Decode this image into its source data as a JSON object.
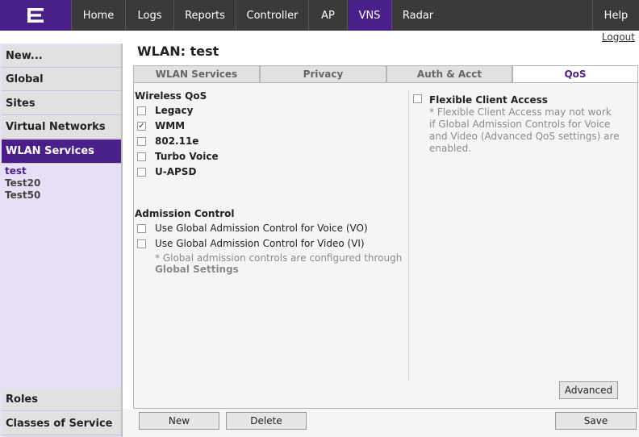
{
  "nav": {
    "items": [
      "Home",
      "Logs",
      "Reports",
      "Controller",
      "AP",
      "VNS",
      "Radar"
    ],
    "help": "Help",
    "logout": "Logout"
  },
  "sidebar": {
    "top_items": [
      "New...",
      "Global",
      "Sites",
      "Virtual Networks",
      "WLAN Services"
    ],
    "sub_items": [
      "test",
      "Test20",
      "Test50"
    ],
    "bottom_items": [
      "Roles",
      "Classes of Service"
    ]
  },
  "page": {
    "title": "WLAN: test"
  },
  "tabs": [
    "WLAN Services",
    "Privacy",
    "Auth & Acct",
    "QoS"
  ],
  "qos": {
    "wireless_title": "Wireless QoS",
    "options": [
      {
        "label": "Legacy",
        "checked": false
      },
      {
        "label": "WMM",
        "checked": true
      },
      {
        "label": "802.11e",
        "checked": false
      },
      {
        "label": "Turbo Voice",
        "checked": false
      },
      {
        "label": "U-APSD",
        "checked": false
      }
    ],
    "admission_title": "Admission Control",
    "admission_options": [
      {
        "label": "Use Global Admission Control for Voice (VO)",
        "checked": false
      },
      {
        "label": "Use Global Admission Control for Video (VI)",
        "checked": false
      }
    ],
    "admission_note": "* Global admission controls are configured through",
    "admission_note_link": "Global Settings",
    "flex_label": "Flexible Client Access",
    "flex_note": [
      "* Flexible Client Access may not work",
      "if Global Admission Controls for Voice",
      "and Video (Advanced QoS settings) are",
      "enabled."
    ],
    "advanced_button": "Advanced"
  },
  "buttons": {
    "new": "New",
    "delete": "Delete",
    "save": "Save"
  },
  "colors": {
    "accent": "#4b1f8a",
    "topbar": "#3a3a3a"
  }
}
